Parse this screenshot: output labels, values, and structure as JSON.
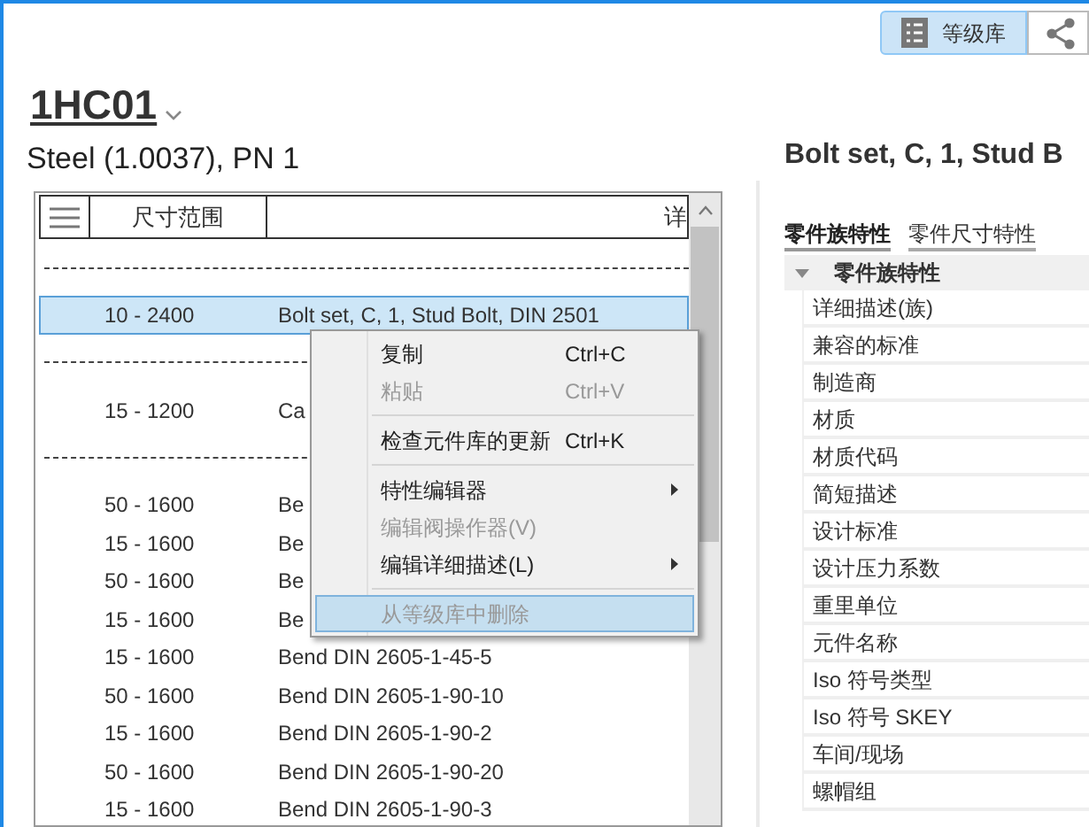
{
  "toolbar": [
    {
      "kind": "spec",
      "label": "等级库",
      "selected": true
    },
    {
      "kind": "share",
      "selected": false
    }
  ],
  "spec": {
    "name": "1HC01",
    "subtitle": "Steel (1.0037), PN 1"
  },
  "table": {
    "columns": [
      "尺寸范围",
      "详"
    ],
    "rows": [
      {
        "kind": "separator"
      },
      {
        "kind": "row",
        "range": "10 - 2400",
        "description": "Bolt set, C, 1, Stud Bolt, DIN 2501",
        "selected": true
      },
      {
        "kind": "separator"
      },
      {
        "kind": "row",
        "range": "15 - 1200",
        "description": "Ca",
        "selected": false
      },
      {
        "kind": "separator"
      },
      {
        "kind": "row",
        "range": "50 - 1600",
        "description": "Be",
        "selected": false
      },
      {
        "kind": "row",
        "range": "15 - 1600",
        "description": "Be",
        "selected": false
      },
      {
        "kind": "row",
        "range": "50 - 1600",
        "description": "Be",
        "selected": false
      },
      {
        "kind": "row",
        "range": "15 - 1600",
        "description": "Be",
        "selected": false
      },
      {
        "kind": "row",
        "range": "15 - 1600",
        "description": "Bend DIN 2605-1-45-5",
        "selected": false
      },
      {
        "kind": "row",
        "range": "50 - 1600",
        "description": "Bend DIN 2605-1-90-10",
        "selected": false
      },
      {
        "kind": "row",
        "range": "15 - 1600",
        "description": "Bend DIN 2605-1-90-2",
        "selected": false
      },
      {
        "kind": "row",
        "range": "50 - 1600",
        "description": "Bend DIN 2605-1-90-20",
        "selected": false
      },
      {
        "kind": "row",
        "range": "15 - 1600",
        "description": "Bend DIN 2605-1-90-3",
        "selected": false
      }
    ]
  },
  "context_menu": [
    {
      "kind": "item",
      "label": "复制",
      "shortcut": "Ctrl+C",
      "disabled": false,
      "selected": false,
      "submenu": false
    },
    {
      "kind": "item",
      "label": "粘贴",
      "shortcut": "Ctrl+V",
      "disabled": true,
      "selected": false,
      "submenu": false
    },
    {
      "kind": "separator"
    },
    {
      "kind": "item",
      "label": "检查元件库的更新",
      "shortcut": "Ctrl+K",
      "disabled": false,
      "selected": false,
      "submenu": false
    },
    {
      "kind": "separator"
    },
    {
      "kind": "item",
      "label": "特性编辑器",
      "disabled": false,
      "selected": false,
      "submenu": true
    },
    {
      "kind": "item",
      "label": "编辑阀操作器(V)",
      "disabled": true,
      "selected": false,
      "submenu": false
    },
    {
      "kind": "item",
      "label": "编辑详细描述(L)",
      "disabled": false,
      "selected": false,
      "submenu": true
    },
    {
      "kind": "separator"
    },
    {
      "kind": "item",
      "label": "从等级库中删除",
      "disabled": true,
      "selected": true,
      "submenu": false
    }
  ],
  "details": {
    "title": "Bolt set, C, 1, Stud B",
    "tabs": [
      {
        "label": "零件族特性",
        "selected": true
      },
      {
        "label": "零件尺寸特性",
        "selected": false
      }
    ],
    "group": {
      "label": "零件族特性",
      "expanded": true
    },
    "properties": [
      "详细描述(族)",
      "兼容的标准",
      "制造商",
      "材质",
      "材质代码",
      "简短描述",
      "设计标准",
      "设计压力系数",
      "重里单位",
      "元件名称",
      "Iso 符号类型",
      "Iso 符号 SKEY",
      "车间/现场",
      "螺帽组"
    ]
  }
}
